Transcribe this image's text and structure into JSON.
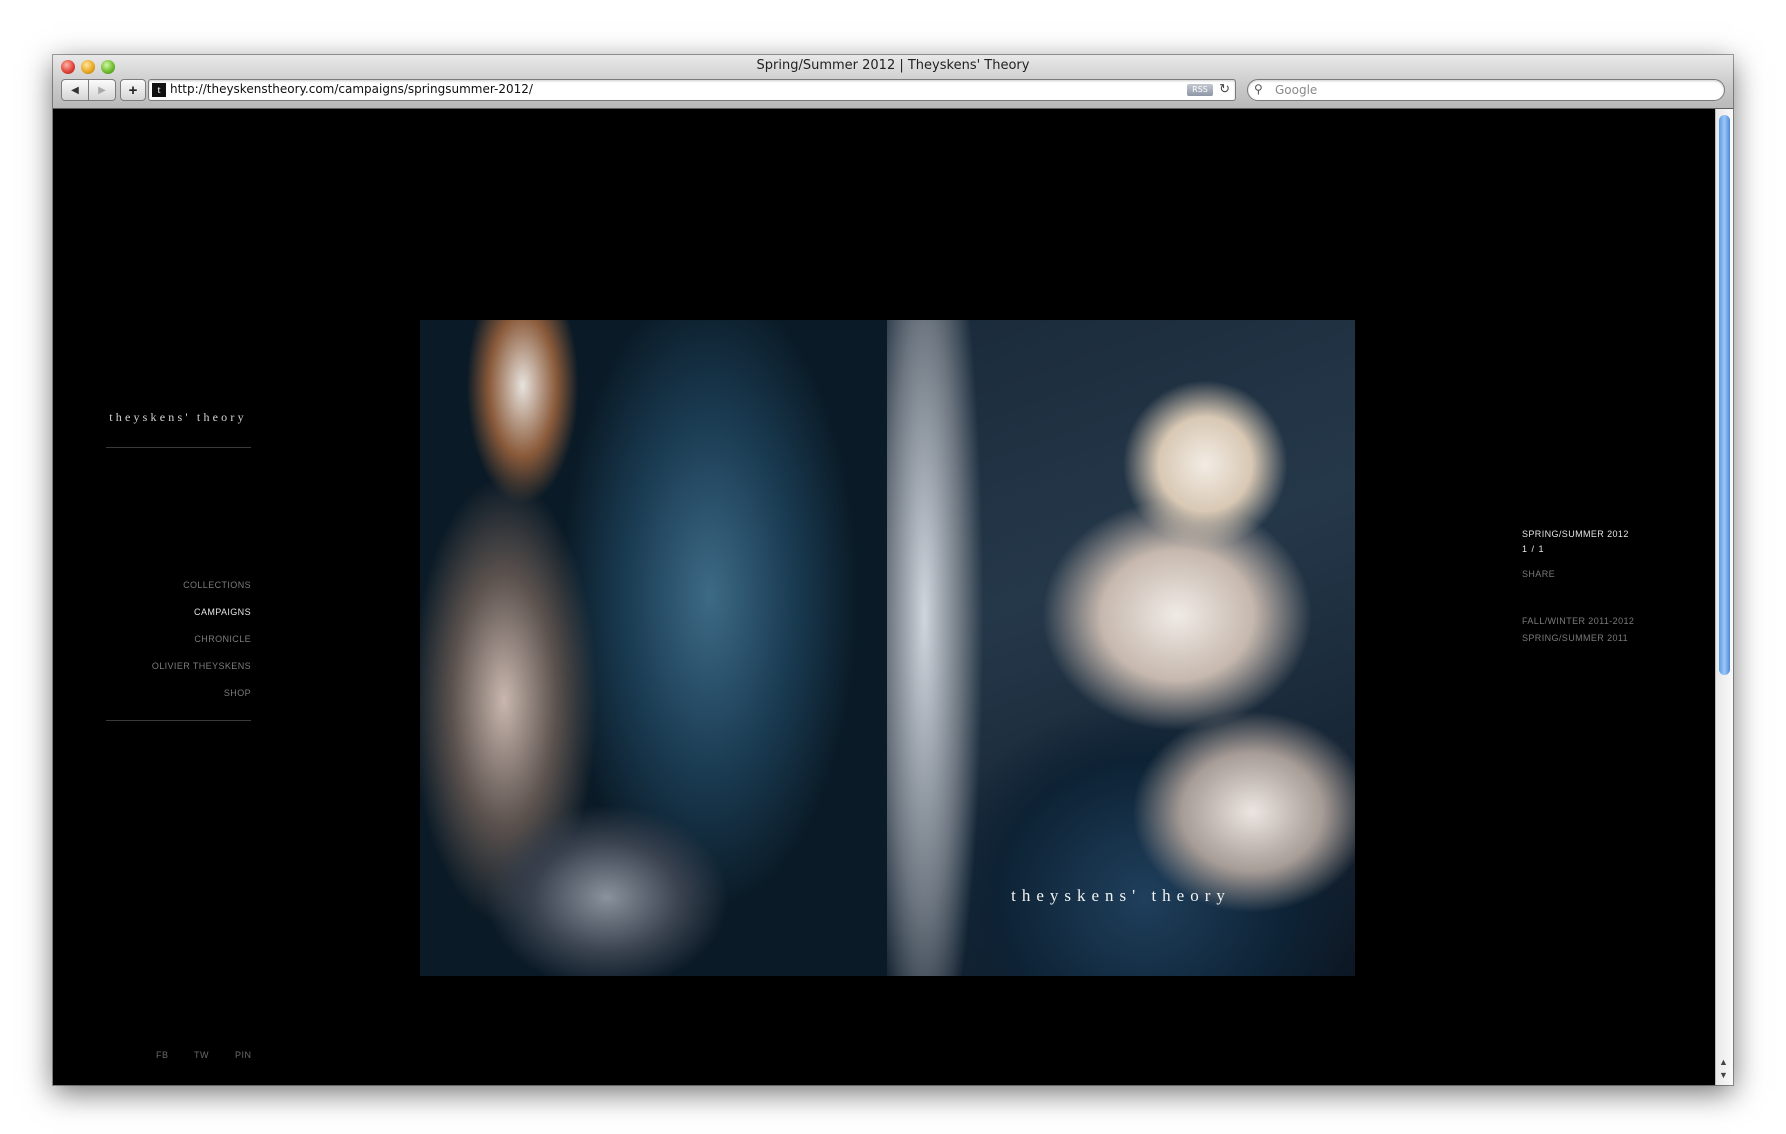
{
  "browser": {
    "window_title": "Spring/Summer 2012 | Theyskens' Theory",
    "url": "http://theyskenstheory.com/campaigns/springsummer-2012/",
    "favicon_letter": "t",
    "rss_label": "RSS",
    "search_placeholder": "Google",
    "back_icon": "◀",
    "forward_icon": "▶",
    "add_icon": "+",
    "reload_icon": "↻",
    "search_icon": "⚲"
  },
  "site": {
    "brand": "theyskens' theory",
    "nav": [
      {
        "label": "COLLECTIONS",
        "active": false
      },
      {
        "label": "CAMPAIGNS",
        "active": true
      },
      {
        "label": "CHRONICLE",
        "active": false
      },
      {
        "label": "OLIVIER THEYSKENS",
        "active": false
      },
      {
        "label": "SHOP",
        "active": false
      }
    ],
    "social": [
      "FB",
      "TW",
      "PIN"
    ]
  },
  "gallery": {
    "caption": "theyskens' theory"
  },
  "sidepanel": {
    "title": "SPRING/SUMMER 2012",
    "count": "1 / 1",
    "share": "SHARE",
    "other_campaigns": [
      "FALL/WINTER 2011-2012",
      "SPRING/SUMMER 2011"
    ]
  },
  "colors": {
    "page_bg": "#000000",
    "nav_active": "#e6e6e6",
    "nav_inactive": "#7c7c7c",
    "scrollbar_accent": "#5e9be6"
  }
}
